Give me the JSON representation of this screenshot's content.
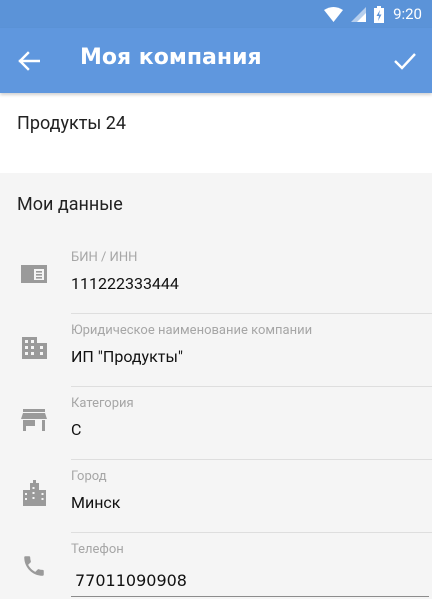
{
  "status_bar": {
    "time": "9:20",
    "icons": [
      "wifi-icon",
      "cellular-signal-icon",
      "battery-charging-icon"
    ]
  },
  "toolbar": {
    "title": "Моя компания",
    "back_icon": "arrow-back-icon",
    "confirm_icon": "check-icon"
  },
  "company": {
    "name": "Продукты 24"
  },
  "section": {
    "title": "Мои данные"
  },
  "fields": [
    {
      "icon": "id-card-icon",
      "label": "БИН / ИНН",
      "value": "111222333444"
    },
    {
      "icon": "building-icon",
      "label": "Юридическое наименование компании",
      "value": "ИП \"Продукты\""
    },
    {
      "icon": "store-icon",
      "label": "Категория",
      "value": "C"
    },
    {
      "icon": "city-icon",
      "label": "Город",
      "value": "Минск"
    },
    {
      "icon": "phone-icon",
      "label": "Телефон",
      "value": "77011090908"
    }
  ],
  "colors": {
    "status_bar": "#5b93d8",
    "toolbar": "#5f97de",
    "background": "#f5f5f5",
    "label": "#a6a6a6",
    "icon": "#9a9a9a"
  }
}
